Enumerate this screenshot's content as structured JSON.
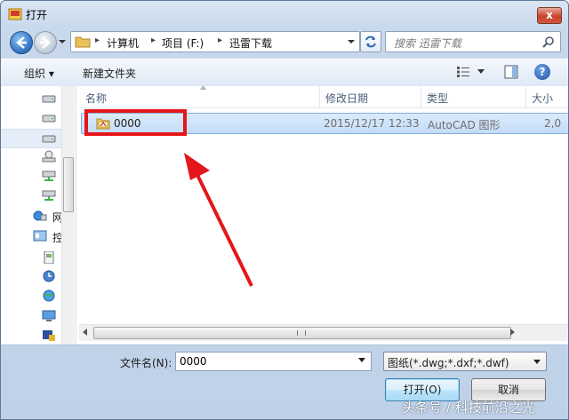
{
  "window": {
    "title": "打开",
    "close_label": "x"
  },
  "address_bar": {
    "crumbs": [
      "计算机",
      "项目 (F:)",
      "迅雷下载"
    ]
  },
  "search": {
    "placeholder": "搜索 迅雷下载"
  },
  "toolbar": {
    "organize_label": "组织 ▾",
    "new_folder_label": "新建文件夹",
    "help_label": "?"
  },
  "nav_pane": {
    "labels": {
      "network": "网",
      "control": "控"
    }
  },
  "columns": {
    "name": "名称",
    "date": "修改日期",
    "type": "类型",
    "size": "大小"
  },
  "files": [
    {
      "name": "0000",
      "date": "2015/12/17 12:33",
      "type": "AutoCAD 图形",
      "size": "2,0"
    }
  ],
  "bottom": {
    "filename_label": "文件名(N):",
    "filename_value": "0000",
    "filetype_value": "图纸(*.dwg;*.dxf;*.dwf)",
    "open_label": "打开(O)",
    "cancel_label": "取消"
  },
  "watermark": "头条号 / 科技前沿之光",
  "colors": {
    "highlight_annotation": "#e4161b",
    "selection_row": "#c3dcf7"
  }
}
